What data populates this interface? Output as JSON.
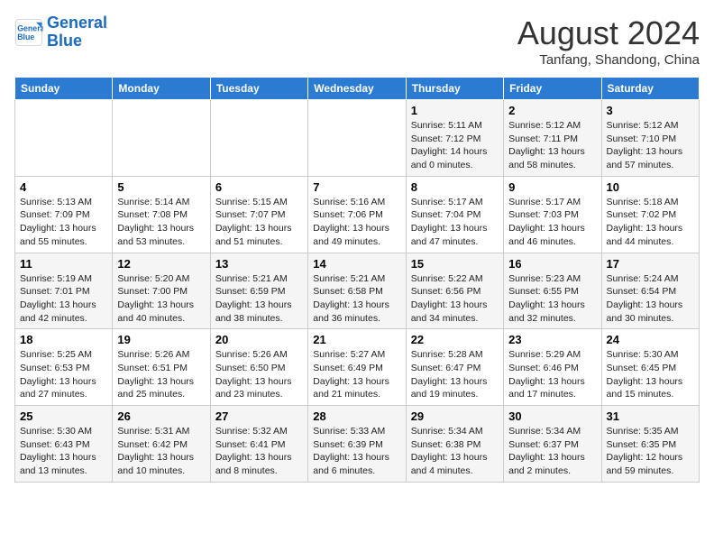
{
  "header": {
    "logo_line1": "General",
    "logo_line2": "Blue",
    "month": "August 2024",
    "location": "Tanfang, Shandong, China"
  },
  "weekdays": [
    "Sunday",
    "Monday",
    "Tuesday",
    "Wednesday",
    "Thursday",
    "Friday",
    "Saturday"
  ],
  "weeks": [
    [
      {
        "day": "",
        "info": ""
      },
      {
        "day": "",
        "info": ""
      },
      {
        "day": "",
        "info": ""
      },
      {
        "day": "",
        "info": ""
      },
      {
        "day": "1",
        "info": "Sunrise: 5:11 AM\nSunset: 7:12 PM\nDaylight: 14 hours\nand 0 minutes."
      },
      {
        "day": "2",
        "info": "Sunrise: 5:12 AM\nSunset: 7:11 PM\nDaylight: 13 hours\nand 58 minutes."
      },
      {
        "day": "3",
        "info": "Sunrise: 5:12 AM\nSunset: 7:10 PM\nDaylight: 13 hours\nand 57 minutes."
      }
    ],
    [
      {
        "day": "4",
        "info": "Sunrise: 5:13 AM\nSunset: 7:09 PM\nDaylight: 13 hours\nand 55 minutes."
      },
      {
        "day": "5",
        "info": "Sunrise: 5:14 AM\nSunset: 7:08 PM\nDaylight: 13 hours\nand 53 minutes."
      },
      {
        "day": "6",
        "info": "Sunrise: 5:15 AM\nSunset: 7:07 PM\nDaylight: 13 hours\nand 51 minutes."
      },
      {
        "day": "7",
        "info": "Sunrise: 5:16 AM\nSunset: 7:06 PM\nDaylight: 13 hours\nand 49 minutes."
      },
      {
        "day": "8",
        "info": "Sunrise: 5:17 AM\nSunset: 7:04 PM\nDaylight: 13 hours\nand 47 minutes."
      },
      {
        "day": "9",
        "info": "Sunrise: 5:17 AM\nSunset: 7:03 PM\nDaylight: 13 hours\nand 46 minutes."
      },
      {
        "day": "10",
        "info": "Sunrise: 5:18 AM\nSunset: 7:02 PM\nDaylight: 13 hours\nand 44 minutes."
      }
    ],
    [
      {
        "day": "11",
        "info": "Sunrise: 5:19 AM\nSunset: 7:01 PM\nDaylight: 13 hours\nand 42 minutes."
      },
      {
        "day": "12",
        "info": "Sunrise: 5:20 AM\nSunset: 7:00 PM\nDaylight: 13 hours\nand 40 minutes."
      },
      {
        "day": "13",
        "info": "Sunrise: 5:21 AM\nSunset: 6:59 PM\nDaylight: 13 hours\nand 38 minutes."
      },
      {
        "day": "14",
        "info": "Sunrise: 5:21 AM\nSunset: 6:58 PM\nDaylight: 13 hours\nand 36 minutes."
      },
      {
        "day": "15",
        "info": "Sunrise: 5:22 AM\nSunset: 6:56 PM\nDaylight: 13 hours\nand 34 minutes."
      },
      {
        "day": "16",
        "info": "Sunrise: 5:23 AM\nSunset: 6:55 PM\nDaylight: 13 hours\nand 32 minutes."
      },
      {
        "day": "17",
        "info": "Sunrise: 5:24 AM\nSunset: 6:54 PM\nDaylight: 13 hours\nand 30 minutes."
      }
    ],
    [
      {
        "day": "18",
        "info": "Sunrise: 5:25 AM\nSunset: 6:53 PM\nDaylight: 13 hours\nand 27 minutes."
      },
      {
        "day": "19",
        "info": "Sunrise: 5:26 AM\nSunset: 6:51 PM\nDaylight: 13 hours\nand 25 minutes."
      },
      {
        "day": "20",
        "info": "Sunrise: 5:26 AM\nSunset: 6:50 PM\nDaylight: 13 hours\nand 23 minutes."
      },
      {
        "day": "21",
        "info": "Sunrise: 5:27 AM\nSunset: 6:49 PM\nDaylight: 13 hours\nand 21 minutes."
      },
      {
        "day": "22",
        "info": "Sunrise: 5:28 AM\nSunset: 6:47 PM\nDaylight: 13 hours\nand 19 minutes."
      },
      {
        "day": "23",
        "info": "Sunrise: 5:29 AM\nSunset: 6:46 PM\nDaylight: 13 hours\nand 17 minutes."
      },
      {
        "day": "24",
        "info": "Sunrise: 5:30 AM\nSunset: 6:45 PM\nDaylight: 13 hours\nand 15 minutes."
      }
    ],
    [
      {
        "day": "25",
        "info": "Sunrise: 5:30 AM\nSunset: 6:43 PM\nDaylight: 13 hours\nand 13 minutes."
      },
      {
        "day": "26",
        "info": "Sunrise: 5:31 AM\nSunset: 6:42 PM\nDaylight: 13 hours\nand 10 minutes."
      },
      {
        "day": "27",
        "info": "Sunrise: 5:32 AM\nSunset: 6:41 PM\nDaylight: 13 hours\nand 8 minutes."
      },
      {
        "day": "28",
        "info": "Sunrise: 5:33 AM\nSunset: 6:39 PM\nDaylight: 13 hours\nand 6 minutes."
      },
      {
        "day": "29",
        "info": "Sunrise: 5:34 AM\nSunset: 6:38 PM\nDaylight: 13 hours\nand 4 minutes."
      },
      {
        "day": "30",
        "info": "Sunrise: 5:34 AM\nSunset: 6:37 PM\nDaylight: 13 hours\nand 2 minutes."
      },
      {
        "day": "31",
        "info": "Sunrise: 5:35 AM\nSunset: 6:35 PM\nDaylight: 12 hours\nand 59 minutes."
      }
    ]
  ]
}
